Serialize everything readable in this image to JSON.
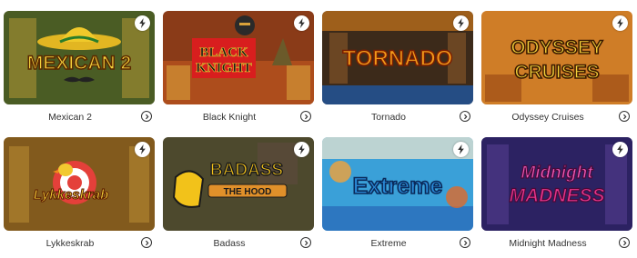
{
  "games": [
    {
      "title": "Mexican 2",
      "logo_line1": "MEXICAN 2",
      "logo_line2": ""
    },
    {
      "title": "Black Knight",
      "logo_line1": "BLACK",
      "logo_line2": "KNIGHT"
    },
    {
      "title": "Tornado",
      "logo_line1": "TORNADO",
      "logo_line2": ""
    },
    {
      "title": "Odyssey Cruises",
      "logo_line1": "ODYSSEY",
      "logo_line2": "CRUISES"
    },
    {
      "title": "Lykkeskrab",
      "logo_line1": "Lykkeskrab",
      "logo_line2": ""
    },
    {
      "title": "Badass",
      "logo_line1": "BADASS",
      "logo_line2": "THE HOOD"
    },
    {
      "title": "Extreme",
      "logo_line1": "Extreme",
      "logo_line2": ""
    },
    {
      "title": "Midnight Madness",
      "logo_line1": "Midnight",
      "logo_line2": "MADNESS"
    }
  ],
  "icons": {
    "badge": "lightning-bolt-icon",
    "open": "chevron-right-circle-icon"
  },
  "colors": {
    "text": "#333333",
    "badge_bg": "#ffffff",
    "bolt": "#333333"
  }
}
